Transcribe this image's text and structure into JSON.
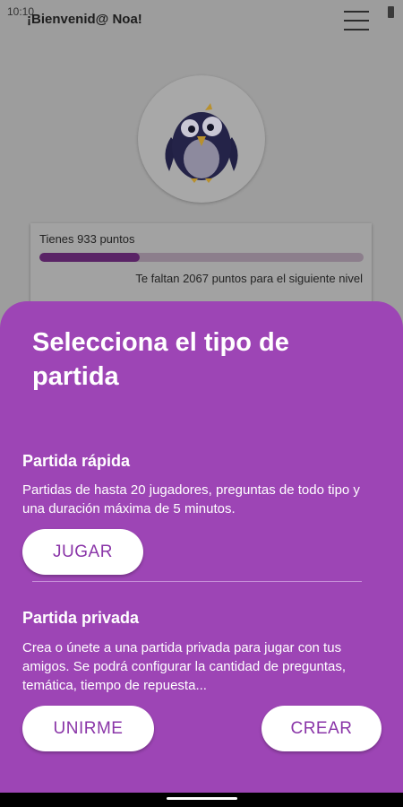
{
  "status_bar": {
    "time": "10:10"
  },
  "header": {
    "greeting": "¡Bienvenid@ Noa!",
    "menu_icon": "hamburger-menu-icon"
  },
  "avatar": {
    "icon": "penguin-avatar-icon"
  },
  "points_card": {
    "points_text": "Tienes 933 puntos",
    "progress_fraction": 0.31,
    "remaining_text": "Te faltan 2067 puntos para el siguiente nivel"
  },
  "sheet": {
    "title": "Selecciona el tipo de partida",
    "quick": {
      "title": "Partida rápida",
      "description": "Partidas de hasta 20 jugadores, preguntas de todo tipo y una duración máxima de 5 minutos.",
      "play_label": "JUGAR"
    },
    "private": {
      "title": "Partida privada",
      "description": "Crea o únete a una partida privada para jugar con tus amigos. Se podrá configurar la cantidad de preguntas, temática, tiempo de repuesta...",
      "join_label": "UNIRME",
      "create_label": "CREAR"
    }
  },
  "colors": {
    "sheet_background": "#9d45b5",
    "button_text": "#8a35a8",
    "progress_fill": "#5a2466"
  }
}
